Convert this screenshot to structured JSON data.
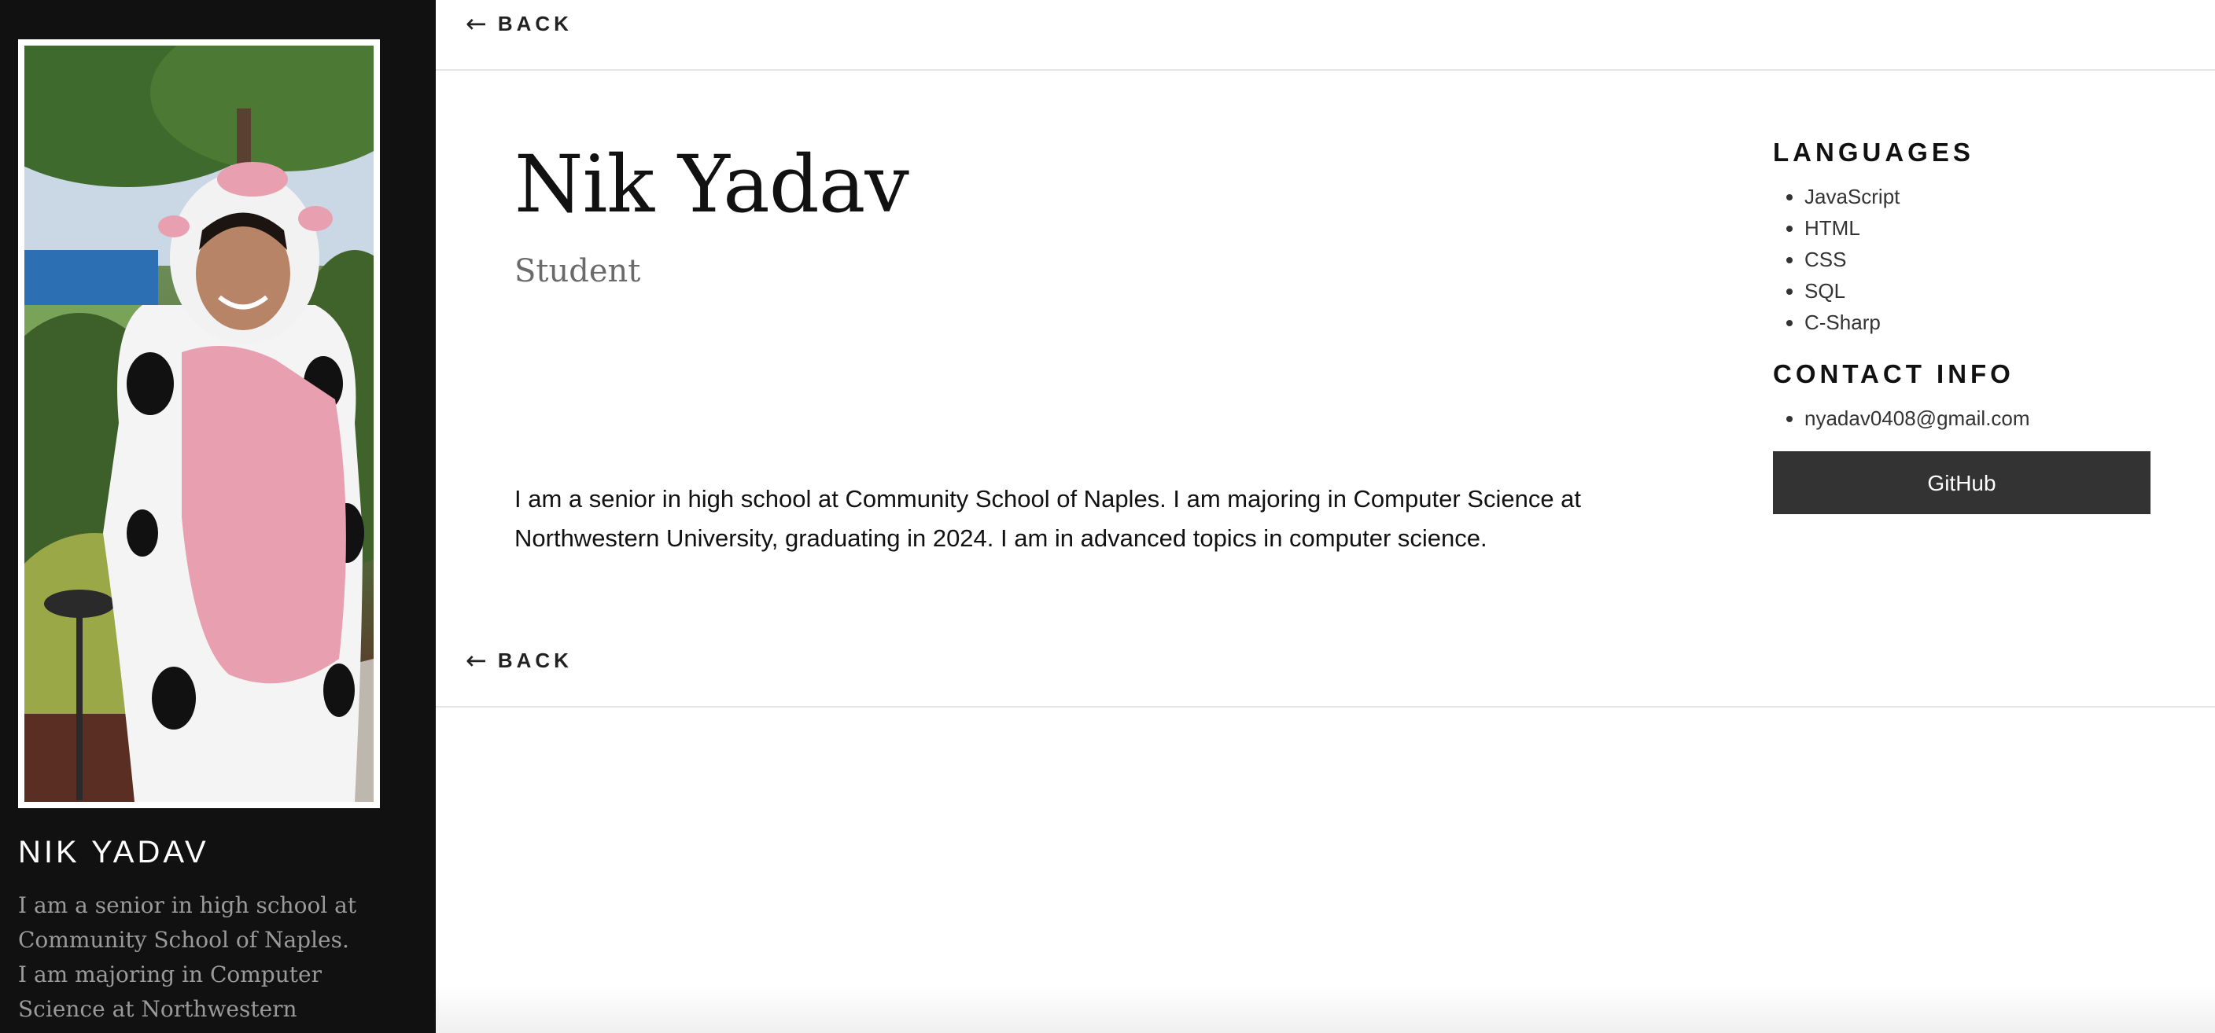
{
  "sidebar": {
    "name": "NIK YADAV",
    "bio": "I am a senior in high school at Community School of Naples. I am majoring in Computer Science at Northwestern"
  },
  "nav": {
    "back_label": "BACK",
    "back_icon": "arrow-left-icon"
  },
  "profile": {
    "name": "Nik Yadav",
    "role": "Student",
    "description": "I am a senior in high school at Community School of Naples. I am majoring in Computer Science at Northwestern University, graduating in 2024. I am in advanced topics in computer science."
  },
  "languages": {
    "heading": "LANGUAGES",
    "items": [
      "JavaScript",
      "HTML",
      "CSS",
      "SQL",
      "C-Sharp"
    ]
  },
  "contact": {
    "heading": "CONTACT INFO",
    "items": [
      "nyadav0408@gmail.com"
    ]
  },
  "github": {
    "label": "GitHub"
  },
  "colors": {
    "sidebar_bg": "#111111",
    "button_bg": "#333333",
    "muted_text": "#6a6a6a"
  }
}
